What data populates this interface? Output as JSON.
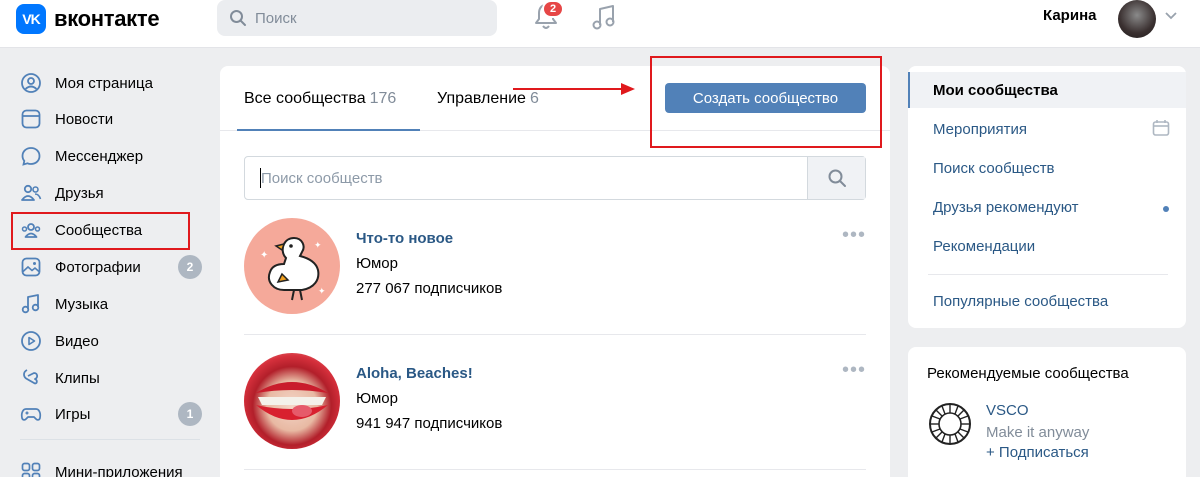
{
  "header": {
    "logo_text": "вконтакте",
    "logo_mark": "VK",
    "search_placeholder": "Поиск",
    "notifications_count": "2",
    "user_name": "Карина"
  },
  "nav": {
    "items": [
      {
        "label": "Моя страница",
        "icon": "user-circle-icon"
      },
      {
        "label": "Новости",
        "icon": "news-icon"
      },
      {
        "label": "Мессенджер",
        "icon": "message-icon"
      },
      {
        "label": "Друзья",
        "icon": "friends-icon"
      },
      {
        "label": "Сообщества",
        "icon": "communities-icon"
      },
      {
        "label": "Фотографии",
        "icon": "photo-icon",
        "badge": "2"
      },
      {
        "label": "Музыка",
        "icon": "music-icon"
      },
      {
        "label": "Видео",
        "icon": "video-icon"
      },
      {
        "label": "Клипы",
        "icon": "clips-icon"
      },
      {
        "label": "Игры",
        "icon": "gamepad-icon",
        "badge": "1"
      },
      {
        "label": "Мини-приложения",
        "icon": "apps-icon"
      }
    ]
  },
  "main": {
    "tabs": [
      {
        "label": "Все сообщества",
        "count": "176"
      },
      {
        "label": "Управление",
        "count": "6"
      }
    ],
    "create_button": "Создать сообщество",
    "search_placeholder": "Поиск сообществ",
    "groups": [
      {
        "name": "Что-то новое",
        "category": "Юмор",
        "subscribers": "277 067 подписчиков"
      },
      {
        "name": "Aloha, Beaches!",
        "category": "Юмор",
        "subscribers": "941 947 подписчиков"
      }
    ],
    "more_glyph": "•••"
  },
  "right_menu": {
    "items": [
      "Мои сообщества",
      "Мероприятия",
      "Поиск сообществ",
      "Друзья рекомендуют",
      "Рекомендации",
      "Популярные сообщества"
    ]
  },
  "recommended": {
    "title": "Рекомендуемые сообщества",
    "name": "VSCO",
    "description": "Make it anyway",
    "subscribe": "+ Подписаться"
  },
  "colors": {
    "accent": "#5181b8",
    "link": "#2a5885",
    "highlight": "#e0191d",
    "logo": "#0077ff"
  }
}
